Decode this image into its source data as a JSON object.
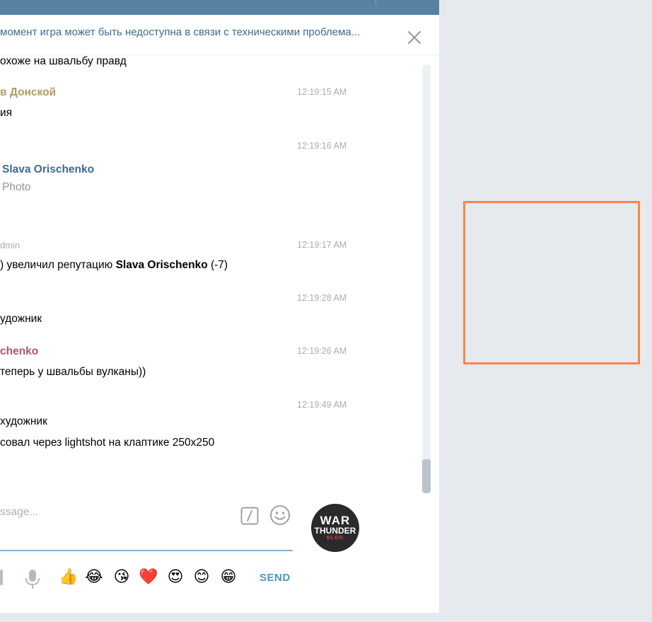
{
  "notice": {
    "text": "момент игра может быть недоступна в связи с техническими проблема..."
  },
  "messages": [
    {
      "text": "охоже на швальбу правд"
    },
    {
      "author": "в Донской",
      "time": "12:19:15 AM",
      "text": "ия"
    },
    {
      "time": "12:19:16 AM",
      "reply_author": "Slava Orischenko",
      "reply_text": "Photo"
    },
    {
      "author": "dmin",
      "time": "12:19:17 AM",
      "text_before": ") увеличил репутацию ",
      "text_bold": "Slava Orischenko",
      "text_after": " (-7)"
    },
    {
      "time": "12:19:28 AM",
      "text": "удожник"
    },
    {
      "author": "chenko",
      "time": "12:19:26 AM",
      "text": "теперь у швальбы вулканы))"
    },
    {
      "time": "12:19:49 AM",
      "text": "художник",
      "text2": "совал через lightshot на клаптике 250x250"
    }
  ],
  "composer": {
    "placeholder": "ssage...",
    "send_label": "SEND",
    "avatar_line1": "WAR",
    "avatar_line2": "THUNDER",
    "avatar_line3": "BLOG",
    "quick_emojis": [
      "👍",
      "😂",
      "😘",
      "❤️",
      "😍",
      "😊",
      "😁"
    ]
  },
  "colors": {
    "header": "#5682a3",
    "accent": "#4a95c9",
    "highlight_box": "#fb8447"
  }
}
